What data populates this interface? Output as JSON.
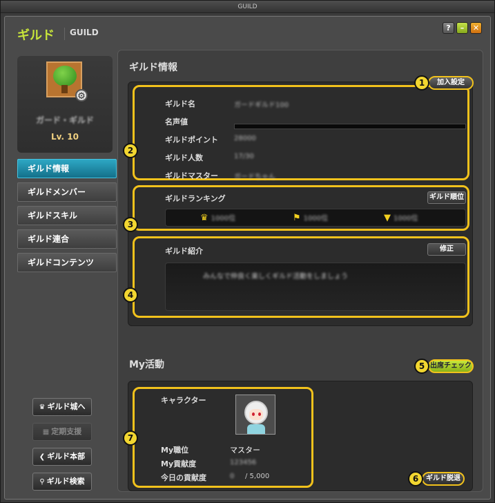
{
  "window": {
    "title": "GUILD"
  },
  "header": {
    "title": "ギルド",
    "subtitle": "GUILD",
    "help": "?",
    "minimize": "–",
    "close": "✕"
  },
  "profile": {
    "guild_name": "ガード・ギルド",
    "level": "Lv. 10"
  },
  "nav": {
    "items": [
      "ギルド情報",
      "ギルドメンバー",
      "ギルドスキル",
      "ギルド連合",
      "ギルドコンテンツ"
    ],
    "active": 0
  },
  "left_buttons": {
    "castle": "ギルド城へ",
    "support": "定期支援",
    "headquarters": "ギルド本部",
    "search": "ギルド検索"
  },
  "guild_info": {
    "title": "ギルド情報",
    "join_settings": "加入設定",
    "rows": [
      {
        "label": "ギルド名",
        "value": "ガードギルド100"
      },
      {
        "label": "名声値",
        "value": ""
      },
      {
        "label": "ギルドポイント",
        "value": "28000"
      },
      {
        "label": "ギルド人数",
        "value": "17/30"
      },
      {
        "label": "ギルドマスター",
        "value": "ガードちゃん"
      }
    ],
    "ranking_title": "ギルドランキング",
    "ranking_button": "ギルド順位",
    "ranking": [
      "1000位",
      "1000位",
      "1000位"
    ],
    "intro_title": "ギルド紹介",
    "intro_edit": "修正",
    "intro_text": "みんなで仲良く楽しくギルド活動をしましょう"
  },
  "my_activity": {
    "title": "My活動",
    "attendance": "出席チェック",
    "character_label": "キャラクター",
    "job_label": "My職位",
    "job_value": "マスター",
    "contribution_label": "My貢献度",
    "contribution_value": "123456",
    "today_label": "今日の貢献度",
    "today_value": "0",
    "today_max": "/ 5,000",
    "leave": "ギルド脱退"
  },
  "markers": [
    "1",
    "2",
    "3",
    "4",
    "5",
    "6",
    "7"
  ],
  "colors": {
    "accent": "#c9e63a",
    "highlight": "#f2c21c",
    "nav_active": "#1e8fab"
  }
}
